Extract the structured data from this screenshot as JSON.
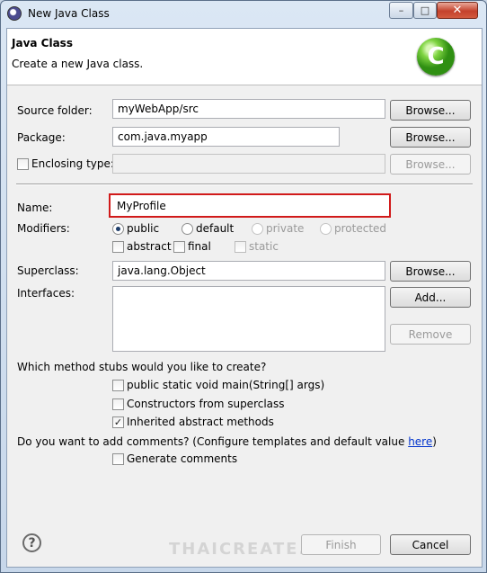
{
  "window": {
    "title": "New Java Class",
    "min_glyph": "–",
    "max_glyph": "□",
    "close_glyph": "✕"
  },
  "header": {
    "title": "Java Class",
    "description": "Create a new Java class.",
    "icon_letter": "C"
  },
  "form": {
    "source_folder": {
      "label": "Source folder:",
      "value": "myWebApp/src",
      "browse": "Browse..."
    },
    "package": {
      "label": "Package:",
      "value": "com.java.myapp",
      "browse": "Browse..."
    },
    "enclosing_type": {
      "label": "Enclosing type:",
      "checked": false,
      "value": "",
      "browse": "Browse..."
    },
    "name": {
      "label": "Name:",
      "value": "MyProfile"
    },
    "modifiers": {
      "label": "Modifiers:",
      "access": [
        {
          "label": "public",
          "checked": true,
          "enabled": true
        },
        {
          "label": "default",
          "checked": false,
          "enabled": true
        },
        {
          "label": "private",
          "checked": false,
          "enabled": false
        },
        {
          "label": "protected",
          "checked": false,
          "enabled": false
        }
      ],
      "flags": [
        {
          "label": "abstract",
          "checked": false,
          "enabled": true
        },
        {
          "label": "final",
          "checked": false,
          "enabled": true
        },
        {
          "label": "static",
          "checked": false,
          "enabled": false
        }
      ]
    },
    "superclass": {
      "label": "Superclass:",
      "value": "java.lang.Object",
      "browse": "Browse..."
    },
    "interfaces": {
      "label": "Interfaces:",
      "add": "Add...",
      "remove": "Remove",
      "items": []
    }
  },
  "stubs": {
    "question": "Which method stubs would you like to create?",
    "options": [
      {
        "label": "public static void main(String[] args)",
        "checked": false
      },
      {
        "label": "Constructors from superclass",
        "checked": false
      },
      {
        "label": "Inherited abstract methods",
        "checked": true
      }
    ]
  },
  "comments": {
    "question_prefix": "Do you want to add comments? (Configure templates and default value ",
    "link": "here",
    "question_suffix": ")",
    "generate_label": "Generate comments",
    "checked": false
  },
  "footer": {
    "help_glyph": "?",
    "finish": "Finish",
    "cancel": "Cancel",
    "watermark": "THAICREATE.COM"
  },
  "colors": {
    "highlight": "#d11a1a",
    "link": "#0033cc",
    "window_frame": "#c9d6e6"
  }
}
